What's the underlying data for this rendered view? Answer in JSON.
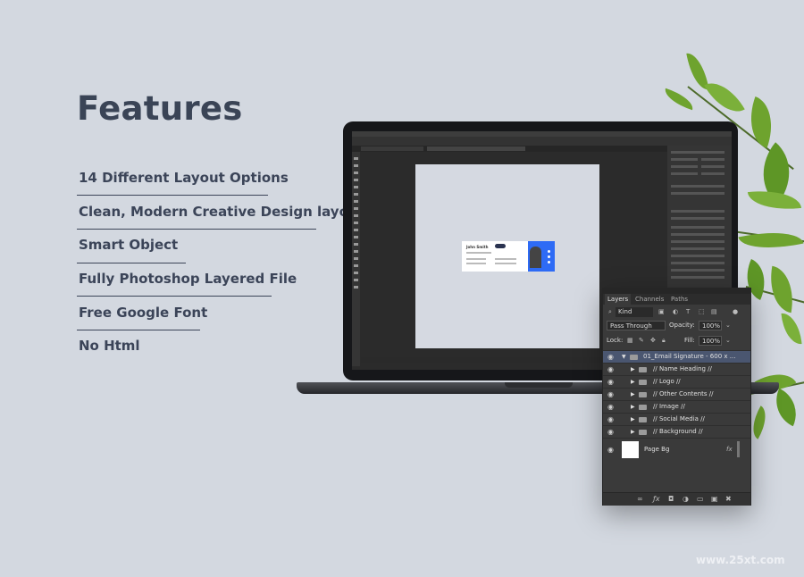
{
  "heading": "Features",
  "features": [
    "14 Different Layout Options",
    "Clean, Modern Creative Design layout",
    "Smart Object",
    "Fully Photoshop Layered File",
    "Free Google Font",
    "No Html"
  ],
  "signature_preview": {
    "name": "John Smith"
  },
  "layers_panel": {
    "tabs": [
      "Layers",
      "Channels",
      "Paths"
    ],
    "filter_kind": "Kind",
    "blend_mode": "Pass Through",
    "opacity_label": "Opacity:",
    "opacity_value": "100%",
    "lock_label": "Lock:",
    "fill_label": "Fill:",
    "fill_value": "100%",
    "group_name": "01_Email Signature - 600 x ...",
    "layers": [
      "// Name Heading //",
      "// Logo //",
      "// Other Contents //",
      "// Image //",
      "// Social Media //",
      "// Background //"
    ],
    "page_bg_layer": "Page Bg",
    "fx_label": "fx"
  },
  "watermark": "www.25xt.com",
  "colors": {
    "background": "#d3d8e0",
    "text": "#3b4458",
    "accent_blue": "#2e6bf5",
    "panel": "#3a3a3a"
  },
  "icons": [
    "search-icon",
    "eye-icon",
    "folder-icon",
    "lock-icon",
    "link-icon",
    "fx-icon",
    "mask-icon",
    "adjustment-icon",
    "new-group-icon",
    "new-layer-icon",
    "trash-icon"
  ]
}
